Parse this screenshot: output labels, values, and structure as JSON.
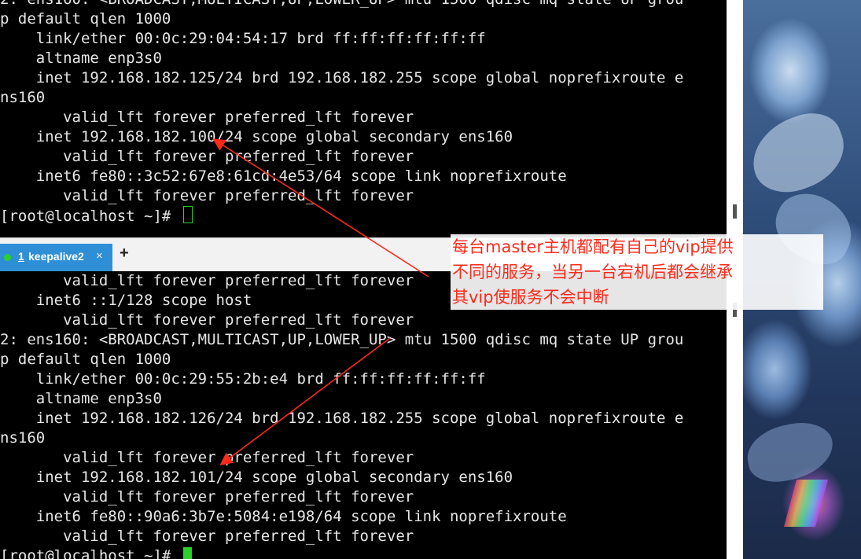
{
  "top_terminal": {
    "lines": [
      "2: ens160: <BROADCAST,MULTICAST,UP,LOWER_UP> mtu 1500 qdisc mq state UP grou",
      "p default qlen 1000",
      "    link/ether 00:0c:29:04:54:17 brd ff:ff:ff:ff:ff:ff",
      "    altname enp3s0",
      "    inet 192.168.182.125/24 brd 192.168.182.255 scope global noprefixroute e",
      "ns160",
      "       valid_lft forever preferred_lft forever",
      "    inet 192.168.182.100/24 scope global secondary ens160",
      "       valid_lft forever preferred_lft forever",
      "    inet6 fe80::3c52:67e8:61cd:4e53/64 scope link noprefixroute",
      "       valid_lft forever preferred_lft forever",
      "[root@localhost ~]# "
    ]
  },
  "tab_bar": {
    "active_tab": {
      "number": "1",
      "label": "keepalive2",
      "close": "×"
    },
    "add": "+",
    "status_color": "#2ad12a",
    "accent_color": "#2f8fd6"
  },
  "bottom_terminal": {
    "lines": [
      "       valid_lft forever preferred_lft forever",
      "    inet6 ::1/128 scope host",
      "       valid_lft forever preferred_lft forever",
      "2: ens160: <BROADCAST,MULTICAST,UP,LOWER_UP> mtu 1500 qdisc mq state UP grou",
      "p default qlen 1000",
      "    link/ether 00:0c:29:55:2b:e4 brd ff:ff:ff:ff:ff:ff",
      "    altname enp3s0",
      "    inet 192.168.182.126/24 brd 192.168.182.255 scope global noprefixroute e",
      "ns160",
      "       valid_lft forever preferred_lft forever",
      "    inet 192.168.182.101/24 scope global secondary ens160",
      "       valid_lft forever preferred_lft forever",
      "    inet6 fe80::90a6:3b7e:5084:e198/64 scope link noprefixroute",
      "       valid_lft forever preferred_lft forever",
      "[root@localhost ~]# "
    ]
  },
  "annotation": {
    "lines": [
      "每台master主机都配有自己的vip提供",
      "不同的服务，当另一台宕机后都会继承",
      "其vip使服务不会中断"
    ],
    "color": "#ff2a1a"
  },
  "terminal_colors": {
    "background": "#000000",
    "text": "#e6e6e6",
    "cursor": "#29d129"
  }
}
